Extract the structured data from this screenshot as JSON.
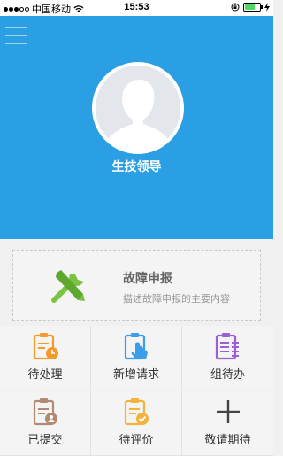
{
  "status_bar": {
    "carrier": "中国移动",
    "time": "15:53",
    "battery_level": 0.7
  },
  "header": {
    "user_name": "生技领导",
    "background_color": "#2b9fe4"
  },
  "fault_report": {
    "title": "故障申报",
    "description": "描述故障申报的主要内容"
  },
  "menu": {
    "items": [
      {
        "label": "待处理",
        "icon": "clipboard-clock-icon",
        "color": "#f39a2d"
      },
      {
        "label": "新增请求",
        "icon": "clipboard-hand-icon",
        "color": "#3d9de8"
      },
      {
        "label": "组待办",
        "icon": "clipboard-list-icon",
        "color": "#9b5fd6"
      },
      {
        "label": "已提交",
        "icon": "clipboard-user-icon",
        "color": "#b08a73"
      },
      {
        "label": "待评价",
        "icon": "clipboard-check-icon",
        "color": "#f3b33d"
      },
      {
        "label": "敬请期待",
        "icon": "plus-icon",
        "color": "#444444"
      }
    ]
  }
}
